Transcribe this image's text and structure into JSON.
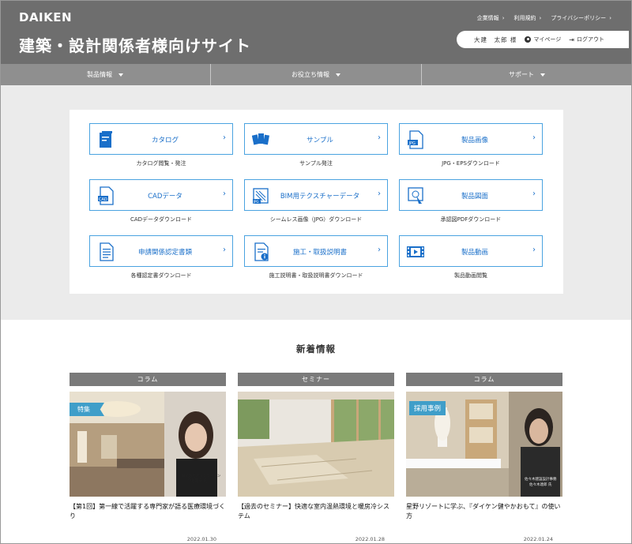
{
  "header": {
    "logo": "DAIKEN",
    "title": "建築・設計関係者様向けサイト",
    "top_links": [
      "企業情報",
      "利用規約",
      "プライバシーポリシー"
    ],
    "user_name": "大建　太郎 様",
    "mypage": "マイページ",
    "logout": "ログアウト"
  },
  "nav": [
    "製品情報",
    "お役立ち情報",
    "サポート"
  ],
  "tiles": [
    {
      "label": "カタログ",
      "caption": "カタログ閲覧・発注",
      "icon": "catalog-icon"
    },
    {
      "label": "サンプル",
      "caption": "サンプル発注",
      "icon": "sample-icon"
    },
    {
      "label": "製品画像",
      "caption": "JPG・EPSダウンロード",
      "icon": "jpg-file-icon"
    },
    {
      "label": "CADデータ",
      "caption": "CADデータダウンロード",
      "icon": "cad-file-icon"
    },
    {
      "label": "BIM用テクスチャーデータ",
      "caption": "シームレス画像（JPG）ダウンロード",
      "icon": "texture-icon"
    },
    {
      "label": "製品図面",
      "caption": "承認図PDFダウンロード",
      "icon": "drawing-icon"
    },
    {
      "label": "申請関係認定書類",
      "caption": "各種認定書ダウンロード",
      "icon": "document-icon"
    },
    {
      "label": "施工・取扱説明書",
      "caption": "施工説明書・取扱説明書ダウンロード",
      "icon": "manual-icon"
    },
    {
      "label": "製品動画",
      "caption": "製品動画閲覧",
      "icon": "video-icon"
    }
  ],
  "news": {
    "title": "新着情報",
    "cards": [
      {
        "category": "コラム",
        "badge": "特集",
        "text": "【第1回】第一線で活躍する専門家が語る医療環境づくり",
        "date": "2022.01.30"
      },
      {
        "category": "セミナー",
        "badge": "",
        "text": "【過去のセミナー】快適な室内温熱環境と暖房冷システム",
        "date": "2022.01.28"
      },
      {
        "category": "コラム",
        "badge": "採用事例",
        "text": "星野リゾートに学ぶ、『ダイケン健やかおもて』の使い方",
        "date": "2022.01.24"
      }
    ]
  },
  "colors": {
    "accent": "#1a6fc9",
    "header": "#6e6e6e",
    "nav": "#8f8f8f",
    "badge": "#3f9ec9"
  }
}
